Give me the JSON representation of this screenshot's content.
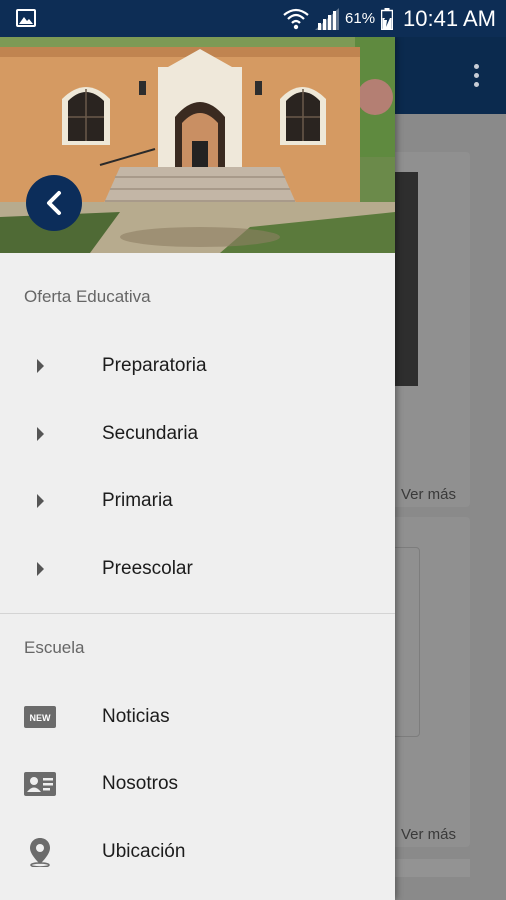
{
  "status_bar": {
    "battery_percent": "61%",
    "time": "10:41 AM"
  },
  "background": {
    "card1_link": "Ver más",
    "card2_link": "Ver más"
  },
  "drawer": {
    "sections": [
      {
        "title": "Oferta Educativa",
        "items": [
          {
            "label": "Preparatoria",
            "icon": "caret-right-icon"
          },
          {
            "label": "Secundaria",
            "icon": "caret-right-icon"
          },
          {
            "label": "Primaria",
            "icon": "caret-right-icon"
          },
          {
            "label": "Preescolar",
            "icon": "caret-right-icon"
          }
        ]
      },
      {
        "title": "Escuela",
        "items": [
          {
            "label": "Noticias",
            "icon": "news-icon"
          },
          {
            "label": "Nosotros",
            "icon": "contact-card-icon"
          },
          {
            "label": "Ubicación",
            "icon": "location-pin-icon"
          }
        ]
      }
    ]
  },
  "colors": {
    "primary": "#0c2d5a",
    "status_bar": "#0d2d55",
    "drawer_bg": "#efefef"
  }
}
